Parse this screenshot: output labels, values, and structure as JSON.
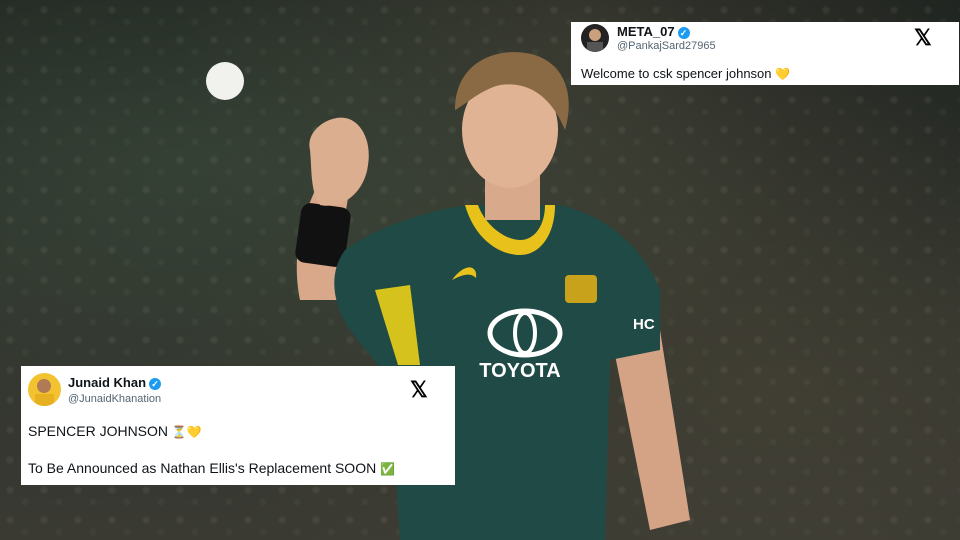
{
  "tweets": [
    {
      "user": "META_07",
      "handle": "@PankajSard27965",
      "verified_icon": "verified-badge-icon",
      "logo": "𝕏",
      "text": "Welcome to csk spencer johnson",
      "emoji": "💛"
    },
    {
      "user": "Junaid Khan",
      "handle": "@JunaidKhanation",
      "verified_icon": "verified-badge-icon",
      "logo": "𝕏",
      "line1": "SPENCER JOHNSON",
      "line1_emoji": "⏳💛",
      "line2": "To Be Announced as Nathan Ellis's Replacement SOON",
      "line2_emoji": "✅"
    }
  ],
  "jersey": {
    "sponsor": "TOYOTA",
    "sleeve_text": "HC"
  },
  "colors": {
    "jersey": "#1f4a45",
    "jersey_trim": "#e8c21a",
    "verified": "#1d9bf0"
  }
}
